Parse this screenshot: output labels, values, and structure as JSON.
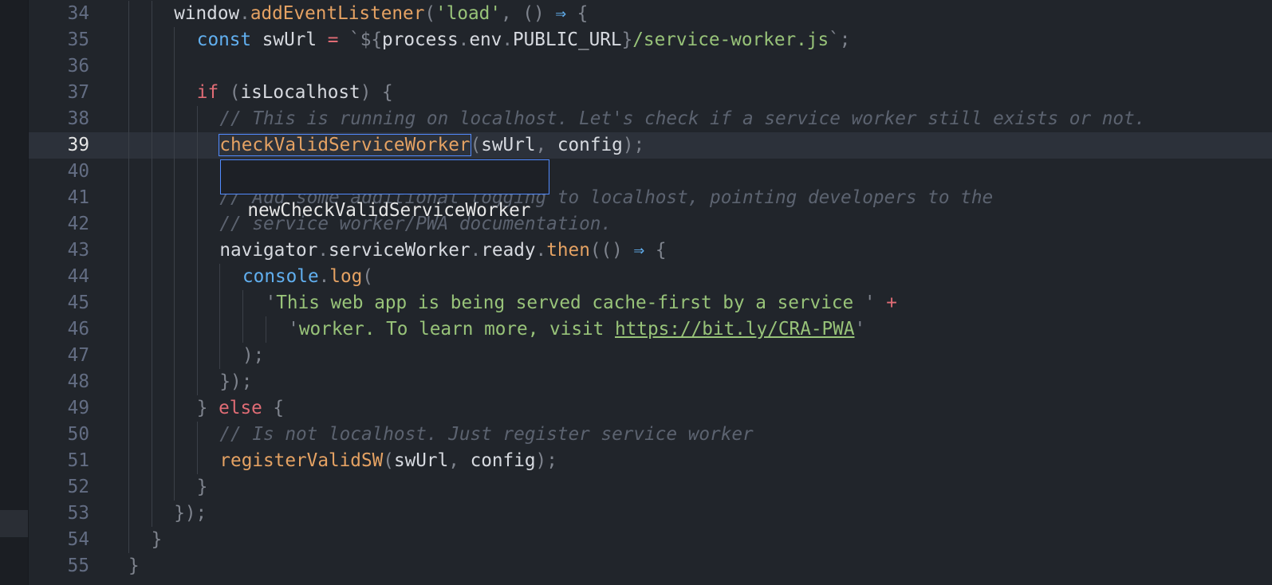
{
  "editor": {
    "lines": [
      {
        "num": "34",
        "indent": 2,
        "tokens": [
          [
            "plain",
            "window"
          ],
          [
            "punct",
            "."
          ],
          [
            "func",
            "addEventListener"
          ],
          [
            "punct",
            "("
          ],
          [
            "string",
            "'load'"
          ],
          [
            "punct",
            ", () "
          ],
          [
            "op",
            "⇒"
          ],
          [
            "punct",
            " {"
          ]
        ]
      },
      {
        "num": "35",
        "indent": 3,
        "tokens": [
          [
            "storage",
            "const"
          ],
          [
            "plain",
            " swUrl "
          ],
          [
            "keyword",
            "="
          ],
          [
            "punct",
            " `${"
          ],
          [
            "plain",
            "process"
          ],
          [
            "punct",
            "."
          ],
          [
            "plain",
            "env"
          ],
          [
            "punct",
            "."
          ],
          [
            "plain",
            "PUBLIC_URL"
          ],
          [
            "punct",
            "}"
          ],
          [
            "string",
            "/service-worker.js"
          ],
          [
            "punct",
            "`;"
          ]
        ]
      },
      {
        "num": "36",
        "indent": 3,
        "tokens": []
      },
      {
        "num": "37",
        "indent": 3,
        "tokens": [
          [
            "keyword",
            "if"
          ],
          [
            "punct",
            " ("
          ],
          [
            "plain",
            "isLocalhost"
          ],
          [
            "punct",
            ") {"
          ]
        ]
      },
      {
        "num": "38",
        "indent": 4,
        "tokens": [
          [
            "comment",
            "// This is running on localhost. Let's check if a service worker still exists or not."
          ]
        ]
      },
      {
        "num": "39",
        "indent": 4,
        "cursor": true,
        "tokens": [
          [
            "func",
            "checkValidServiceWorker",
            "sel"
          ],
          [
            "punct",
            "("
          ],
          [
            "plain",
            "swUrl"
          ],
          [
            "punct",
            ", "
          ],
          [
            "plain",
            "config"
          ],
          [
            "punct",
            ");"
          ]
        ]
      },
      {
        "num": "40",
        "indent": 4,
        "tokens": []
      },
      {
        "num": "41",
        "indent": 4,
        "tokens": [
          [
            "comment",
            "// Add some additional logging to localhost, pointing developers to the"
          ]
        ]
      },
      {
        "num": "42",
        "indent": 4,
        "tokens": [
          [
            "comment",
            "// service worker/PWA documentation."
          ]
        ]
      },
      {
        "num": "43",
        "indent": 4,
        "tokens": [
          [
            "plain",
            "navigator"
          ],
          [
            "punct",
            "."
          ],
          [
            "plain",
            "serviceWorker"
          ],
          [
            "punct",
            "."
          ],
          [
            "plain",
            "ready"
          ],
          [
            "punct",
            "."
          ],
          [
            "func",
            "then"
          ],
          [
            "punct",
            "(() "
          ],
          [
            "op",
            "⇒"
          ],
          [
            "punct",
            " {"
          ]
        ]
      },
      {
        "num": "44",
        "indent": 5,
        "tokens": [
          [
            "storage",
            "console"
          ],
          [
            "punct",
            "."
          ],
          [
            "func",
            "log"
          ],
          [
            "punct",
            "("
          ]
        ]
      },
      {
        "num": "45",
        "indent": 6,
        "tokens": [
          [
            "punct",
            "'"
          ],
          [
            "string",
            "This web app is being served cache-first by a service "
          ],
          [
            "punct",
            "'"
          ],
          [
            "plus",
            " +"
          ]
        ]
      },
      {
        "num": "46",
        "indent": 7,
        "tokens": [
          [
            "punct",
            "'"
          ],
          [
            "string",
            "worker. To learn more, visit "
          ],
          [
            "link",
            "https://bit.ly/CRA-PWA"
          ],
          [
            "punct",
            "'"
          ]
        ]
      },
      {
        "num": "47",
        "indent": 5,
        "tokens": [
          [
            "punct",
            ");"
          ]
        ]
      },
      {
        "num": "48",
        "indent": 4,
        "tokens": [
          [
            "punct",
            "});"
          ]
        ]
      },
      {
        "num": "49",
        "indent": 3,
        "tokens": [
          [
            "punct",
            "} "
          ],
          [
            "keyword",
            "else"
          ],
          [
            "punct",
            " {"
          ]
        ]
      },
      {
        "num": "50",
        "indent": 4,
        "tokens": [
          [
            "comment",
            "// Is not localhost. Just register service worker"
          ]
        ]
      },
      {
        "num": "51",
        "indent": 4,
        "tokens": [
          [
            "func",
            "registerValidSW"
          ],
          [
            "punct",
            "("
          ],
          [
            "plain",
            "swUrl"
          ],
          [
            "punct",
            ", "
          ],
          [
            "plain",
            "config"
          ],
          [
            "punct",
            ");"
          ]
        ]
      },
      {
        "num": "52",
        "indent": 3,
        "tokens": [
          [
            "punct",
            "}"
          ]
        ]
      },
      {
        "num": "53",
        "indent": 2,
        "tokens": [
          [
            "punct",
            "});"
          ]
        ]
      },
      {
        "num": "54",
        "indent": 1,
        "tokens": [
          [
            "punct",
            "}"
          ]
        ]
      },
      {
        "num": "55",
        "indent": 0,
        "tokens": [
          [
            "punct",
            "}"
          ]
        ]
      }
    ]
  },
  "autocomplete": {
    "suggestion": "newCheckValidServiceWorker"
  },
  "colors": {
    "background": "#21252b",
    "cursor_line": "#2c313a",
    "selection_border": "#528bff"
  }
}
